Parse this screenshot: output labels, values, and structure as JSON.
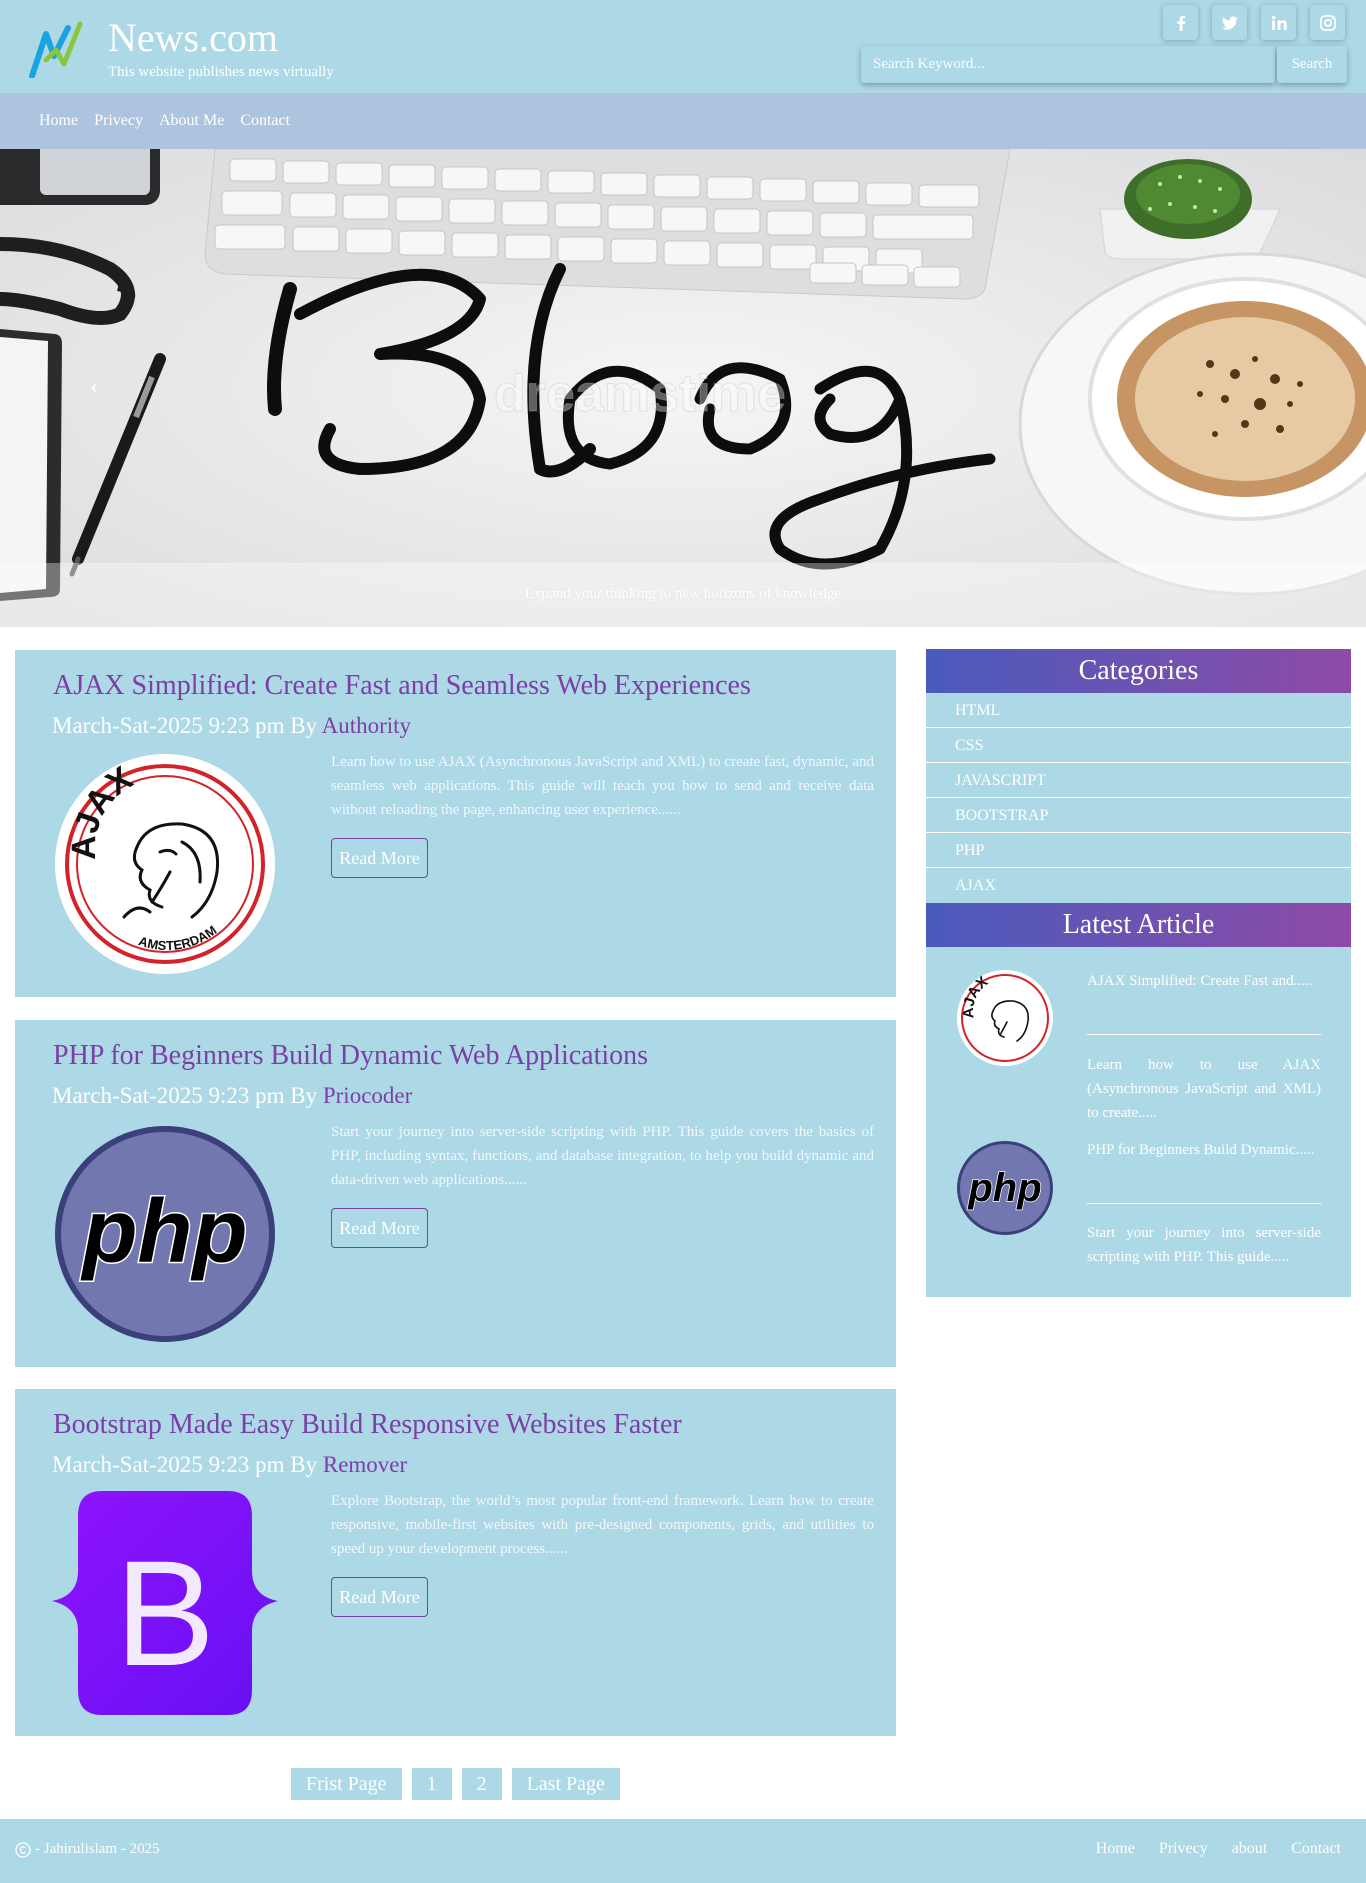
{
  "header": {
    "site_title": "News.com",
    "tagline": "This website publishes news virtually",
    "search_placeholder": "Search Keyword...",
    "search_button": "Search",
    "social": [
      "facebook-icon",
      "twitter-icon",
      "linkedin-icon",
      "instagram-icon"
    ]
  },
  "nav": {
    "items": [
      "Home",
      "Privecy",
      "About Me",
      "Contact"
    ]
  },
  "hero": {
    "image_text": "Blog",
    "watermark": "dreamstime",
    "caption": "Expand your thinking to new horizons of knowledge"
  },
  "articles": [
    {
      "title": "AJAX Simplified: Create Fast and Seamless Web Experiences",
      "date": "March-Sat-2025 9:23 pm By",
      "author": "Authority",
      "excerpt": "Learn how to use AJAX (Asynchronous JavaScript and XML) to create fast, dynamic, and seamless web applications. This guide will teach you how to send and receive data without reloading the page, enhancing user experience......",
      "read_more": "Read More",
      "image": "ajax-logo"
    },
    {
      "title": "PHP for Beginners Build Dynamic Web Applications",
      "date": "March-Sat-2025 9:23 pm By",
      "author": "Priocoder",
      "excerpt": "Start your journey into server-side scripting with PHP. This guide covers the basics of PHP, including syntax, functions, and database integration, to help you build dynamic and data-driven web applications......",
      "read_more": "Read More",
      "image": "php-logo"
    },
    {
      "title": "Bootstrap Made Easy Build Responsive Websites Faster",
      "date": "March-Sat-2025 9:23 pm By",
      "author": "Remover",
      "excerpt": "Explore Bootstrap, the world’s most popular front-end framework. Learn how to create responsive, mobile-first websites with pre-designed components, grids, and utilities to speed up your development process......",
      "read_more": "Read More",
      "image": "bootstrap-logo"
    }
  ],
  "pagination": {
    "first": "Frist Page",
    "pages": [
      "1",
      "2"
    ],
    "last": "Last Page"
  },
  "sidebar": {
    "categories_title": "Categories",
    "categories": [
      "HTML",
      "CSS",
      "JAVASCRIPT",
      "BOOTSTRAP",
      "PHP",
      "AJAX"
    ],
    "latest_title": "Latest Article",
    "latest": [
      {
        "title": "AJAX Simplified: Create Fast and.....",
        "excerpt": "Learn how to use AJAX (Asynchronous JavaScript and XML) to create....."
      },
      {
        "title": "PHP for Beginners Build Dynamic.....",
        "excerpt": "Start your journey into server-side scripting with PHP. This guide....."
      }
    ]
  },
  "footer": {
    "copyright": "- Jahirulislam - 2025",
    "links": [
      "Home",
      "Privecy",
      "about",
      "Contact"
    ]
  },
  "colors": {
    "header_bg": "#add8e6",
    "nav_bg": "#adc4df",
    "accent_purple": "#7b3fa6",
    "gradient_start": "#4a5bbd",
    "gradient_end": "#8e4aa6"
  }
}
